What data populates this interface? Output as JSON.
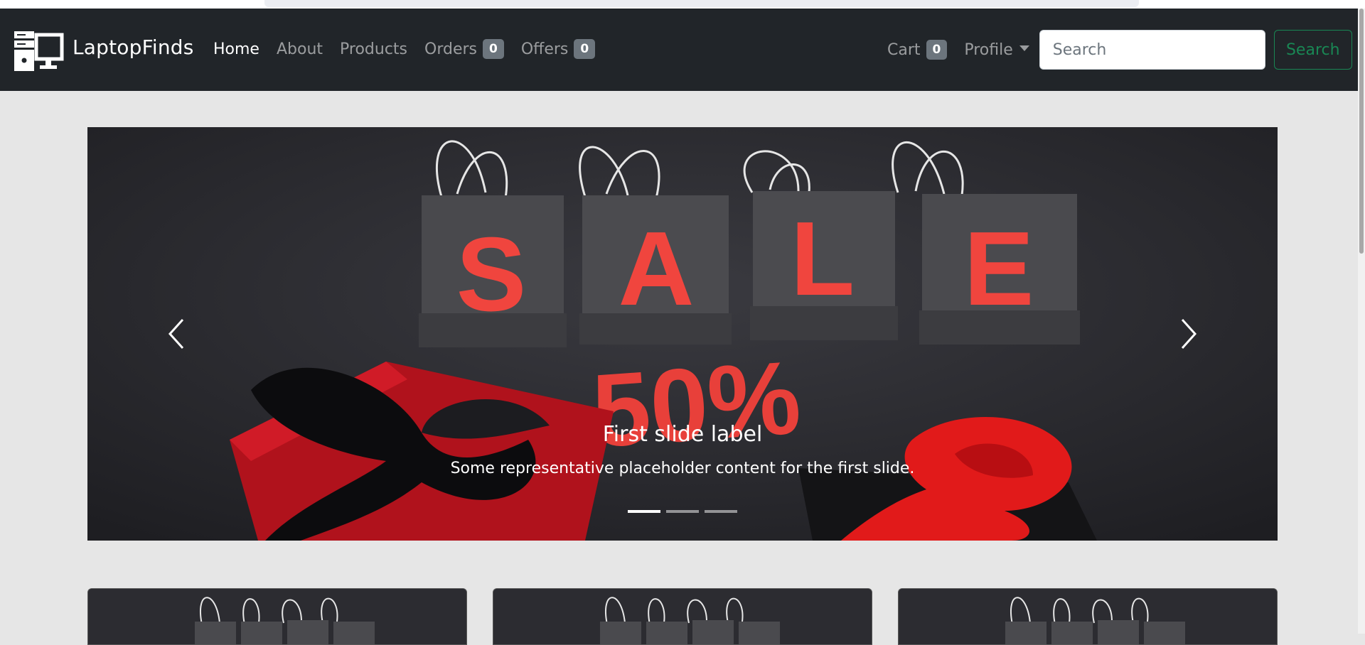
{
  "brand": {
    "name": "LaptopFinds",
    "logo_icon": "computer-desktop-icon"
  },
  "nav": {
    "links": [
      {
        "label": "Home",
        "active": true
      },
      {
        "label": "About"
      },
      {
        "label": "Products"
      },
      {
        "label": "Orders",
        "badge": "0"
      },
      {
        "label": "Offers",
        "badge": "0"
      }
    ],
    "cart": {
      "label": "Cart",
      "badge": "0"
    },
    "profile": {
      "label": "Profile"
    },
    "search": {
      "placeholder": "Search",
      "value": ""
    },
    "search_button": "Search"
  },
  "carousel": {
    "slide_image_text": {
      "bag_letters": [
        "S",
        "A",
        "L",
        "E"
      ],
      "discount": "50%"
    },
    "caption_title": "First slide label",
    "caption_text": "Some representative placeholder content for the first slide.",
    "indicators": 3,
    "active_index": 0,
    "prev_icon": "chevron-left-icon",
    "next_icon": "chevron-right-icon"
  },
  "cards": {
    "count": 3,
    "image": "sale-bags-image"
  },
  "colors": {
    "navbar": "#212529",
    "page_bg": "#e6e6e6",
    "accent_green": "#198754",
    "badge": "#6c757d",
    "sale_red": "#f0453e"
  }
}
